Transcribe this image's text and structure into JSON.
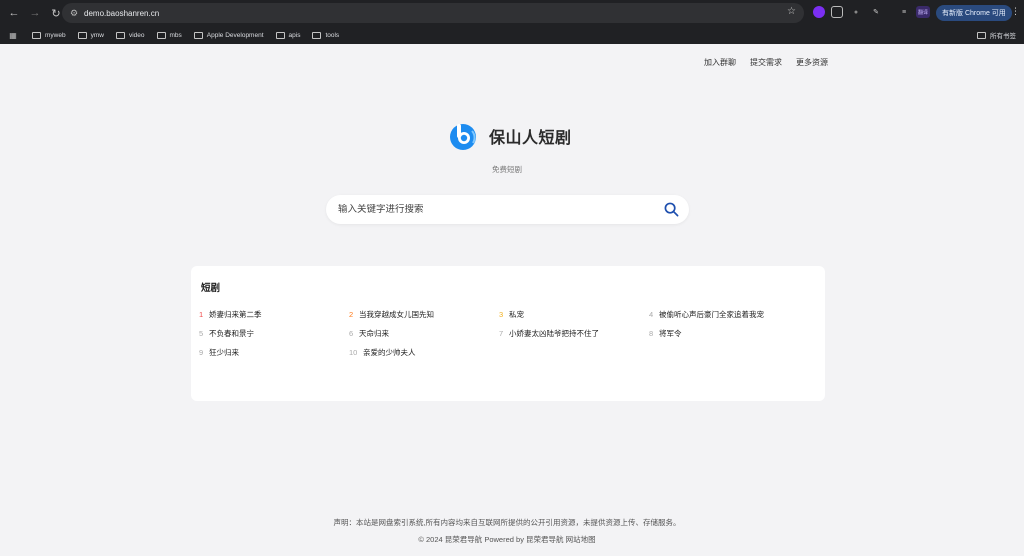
{
  "browser": {
    "url": "demo.baoshanren.cn",
    "update_label": "有新版 Chrome 可用",
    "ext_badge": "翻译",
    "bookmarks": [
      "myweb",
      "ymw",
      "video",
      "mbs",
      "Apple Development",
      "apis",
      "tools"
    ],
    "all_bookmarks_label": "所有书签"
  },
  "header": {
    "links": [
      "加入群聊",
      "提交需求",
      "更多资源"
    ]
  },
  "brand": {
    "name": "保山人短剧",
    "subtitle": "免费短剧",
    "logo_colors": {
      "primary": "#1d8cf0",
      "light": "#7ec8ff"
    }
  },
  "search": {
    "placeholder": "输入关键字进行搜索"
  },
  "list": {
    "title": "短剧",
    "items": [
      {
        "rank": "1",
        "title": "娇妻归来第二季"
      },
      {
        "rank": "2",
        "title": "当我穿越成女儿国先知"
      },
      {
        "rank": "3",
        "title": "私宠"
      },
      {
        "rank": "4",
        "title": "被偷听心声后豪门全家追着我宠"
      },
      {
        "rank": "5",
        "title": "不负春和景宁"
      },
      {
        "rank": "6",
        "title": "天命归来"
      },
      {
        "rank": "7",
        "title": "小娇妻太凶陆爷把持不住了"
      },
      {
        "rank": "8",
        "title": "将军令"
      },
      {
        "rank": "9",
        "title": "狂少归来"
      },
      {
        "rank": "10",
        "title": "亲爱的少帅夫人"
      }
    ]
  },
  "footer": {
    "disclaimer": "声明：本站是网盘索引系统,所有内容均来自互联网所提供的公开引用资源，未提供资源上传、存储服务。",
    "copyright": "© 2024 昆荣君导航 Powered by 昆荣君导航 网站地图"
  },
  "colors": {
    "rank1": "#f04b4b",
    "rank2": "#ff7a1a",
    "rank3": "#f2b01e",
    "rank_other": "#aaaaaa"
  }
}
